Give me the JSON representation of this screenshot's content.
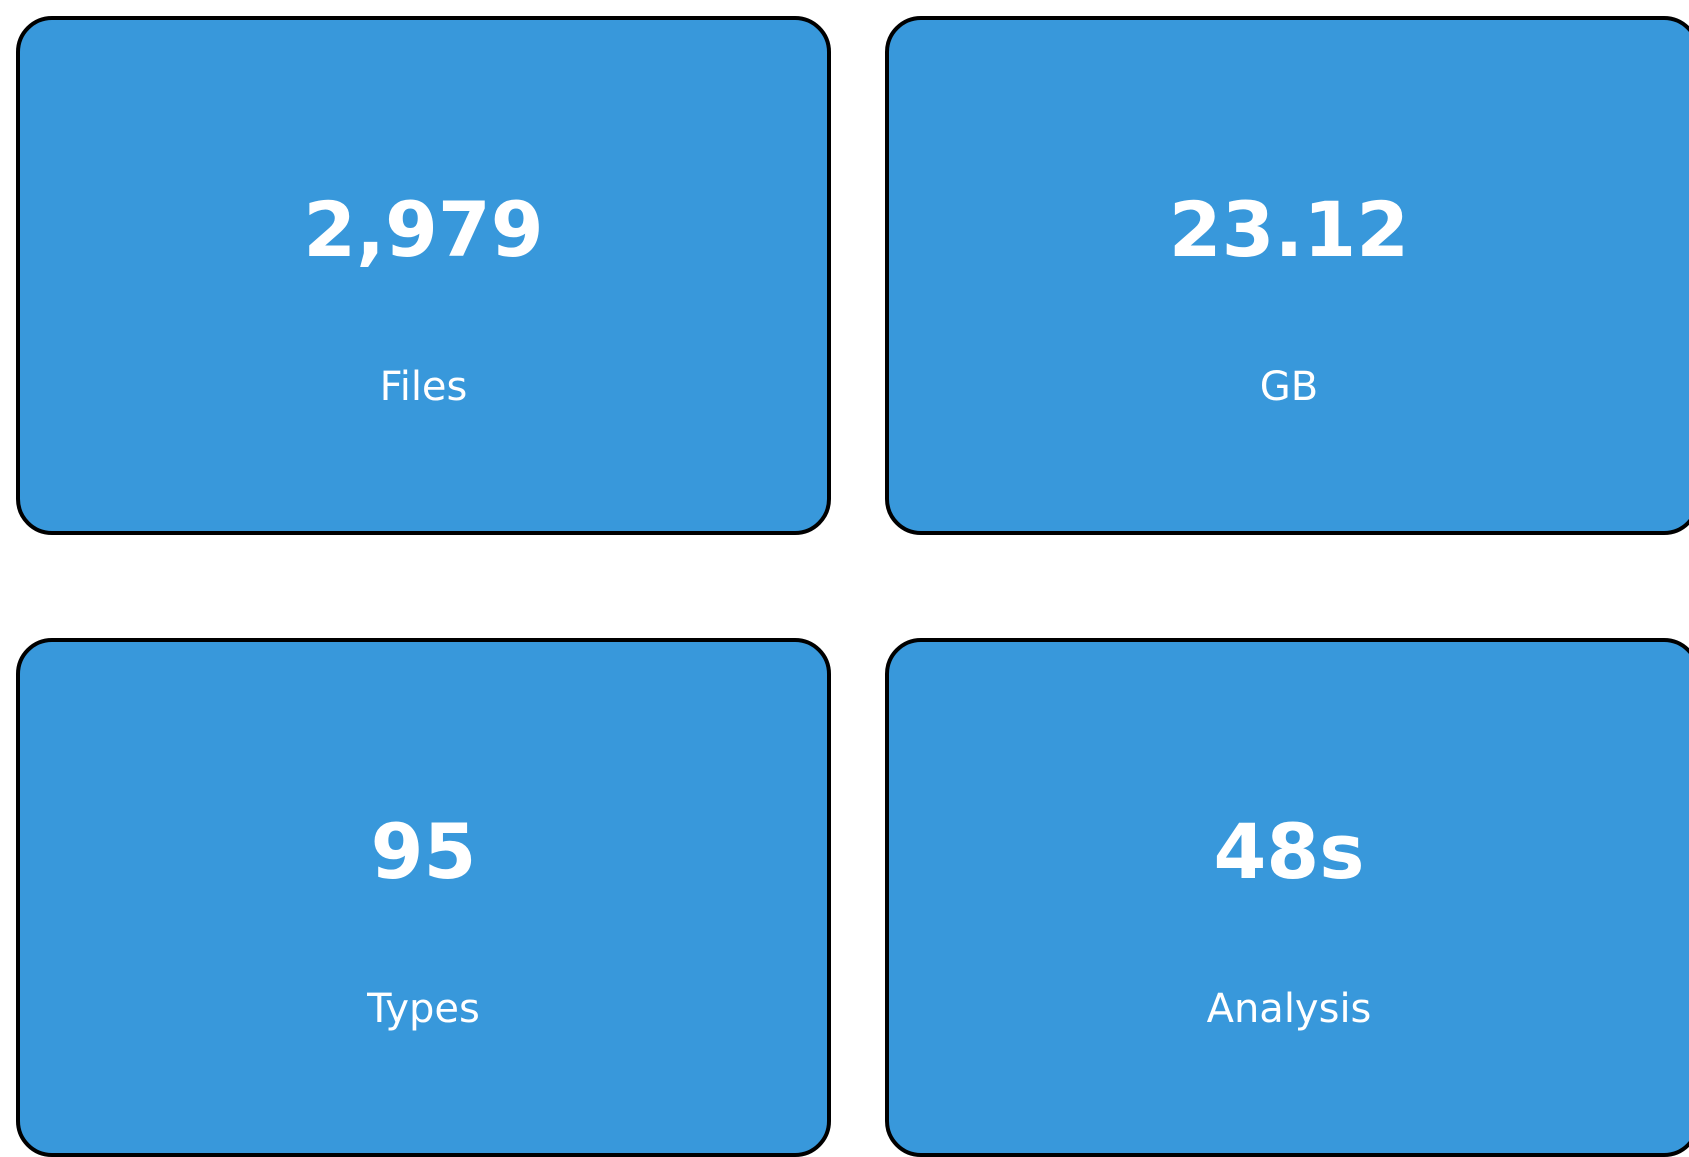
{
  "colors": {
    "card_background": "#3898db",
    "card_border": "#000000",
    "text": "#ffffff",
    "page_background": "#ffffff"
  },
  "cards": [
    {
      "value": "2,979",
      "label": "Files"
    },
    {
      "value": "23.12",
      "label": "GB"
    },
    {
      "value": "95",
      "label": "Types"
    },
    {
      "value": "48s",
      "label": "Analysis"
    }
  ]
}
